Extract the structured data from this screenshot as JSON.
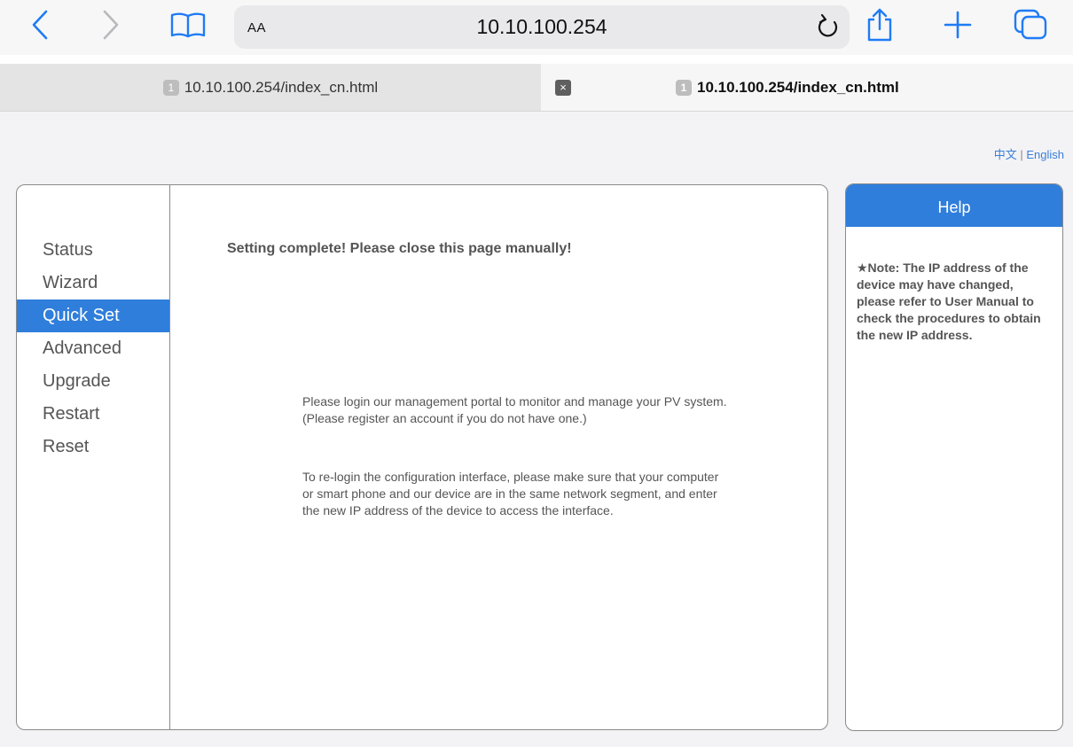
{
  "browser": {
    "address": {
      "aa_label": "AA",
      "url": "10.10.100.254"
    },
    "tabs": [
      {
        "number": "1",
        "title": "10.10.100.254/index_cn.html"
      },
      {
        "number": "1",
        "title": "10.10.100.254/index_cn.html",
        "close_label": "×"
      }
    ]
  },
  "page": {
    "lang": {
      "chinese": "中文",
      "separator": " | ",
      "english": "English"
    },
    "nav": [
      "Status",
      "Wizard",
      "Quick Set",
      "Advanced",
      "Upgrade",
      "Restart",
      "Reset"
    ],
    "nav_active": "Quick Set",
    "main": {
      "complete_message": "Setting complete! Please close this page manually!",
      "portal_message": "Please login our management portal to monitor and manage your PV system.(Please register an account if you do not have one.)",
      "relogin_message": "To re-login the configuration interface, please make sure that your computer or smart phone and our device are in the same network segment, and enter the new IP address of the device to access the interface."
    },
    "help": {
      "title": "Help",
      "note": "★Note: The IP address of the device may have changed, please refer to User Manual to check the procedures to obtain the new IP address."
    }
  },
  "colors": {
    "accent": "#2f7edb",
    "link": "#3b7fd9",
    "ios_blue": "#1f7bf6"
  },
  "icons": [
    "back-icon",
    "forward-icon",
    "bookmarks-icon",
    "reload-icon",
    "share-icon",
    "new-tab-icon",
    "tabs-overview-icon"
  ]
}
